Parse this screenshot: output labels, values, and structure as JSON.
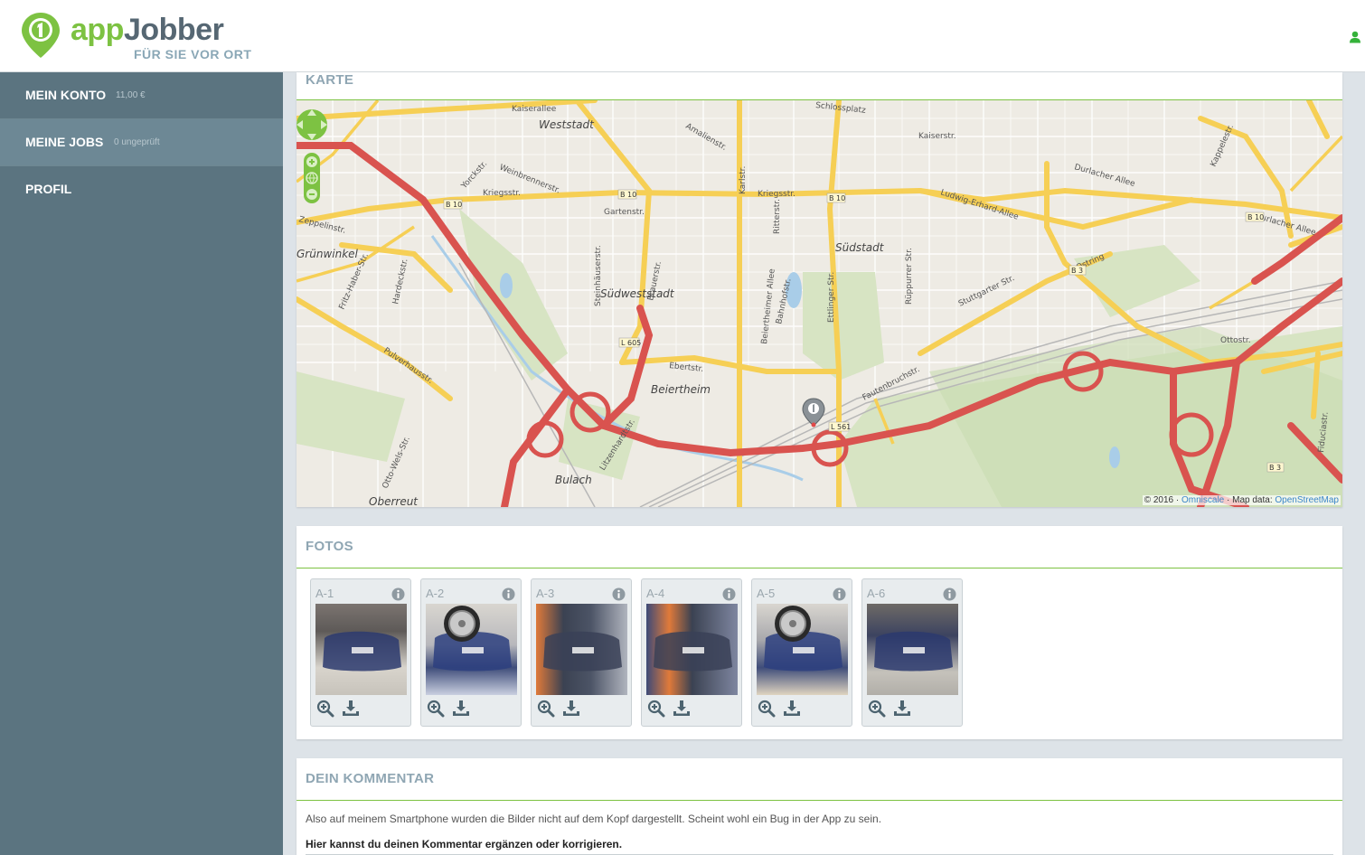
{
  "header": {
    "logo_app": "app",
    "logo_jobber": "Jobber",
    "logo_subtitle": "FÜR SIE VOR ORT",
    "brand_color": "#7dc242",
    "user_icon": "user-icon"
  },
  "sidebar": {
    "items": [
      {
        "label": "MEIN KONTO",
        "meta": "11,00 €"
      },
      {
        "label": "MEINE JOBS",
        "meta": "0 ungeprüft"
      },
      {
        "label": "PROFIL",
        "meta": ""
      }
    ]
  },
  "map_panel": {
    "title": "KARTE",
    "labels": {
      "weststadt": "Weststadt",
      "suedweststadt": "Südweststadt",
      "suedstadt": "Südstadt",
      "beiertheim": "Beiertheim",
      "bulach": "Bulach",
      "oberreut": "Oberreut",
      "gruenwinkel": "Grünwinkel",
      "kaiserallee": "Kaiserallee",
      "kaiserstr": "Kaiserstr.",
      "kriegsstr_w": "Kriegsstr.",
      "kriegsstr_e": "Kriegsstr.",
      "ludwig_erhard": "Ludwig-Erhard-Allee",
      "durlacher_allee": "Durlacher Allee",
      "durlacher_allee_2": "Durlacher Allee",
      "schlossplatz": "Schlossplatz",
      "amalienstr": "Amalienstr.",
      "gartenstr": "Gartenstr.",
      "weinbrennerstr": "Weinbrennerstr.",
      "yorckstr": "Yorckstr.",
      "zeppelinstr": "Zeppelinstr.",
      "ebertstr": "Ebertstr.",
      "stuttgarter": "Stuttgarter Str.",
      "ostring": "Ostring",
      "kappelestr": "Kappelestr.",
      "fautenbruchstr": "Fautenbruchstr.",
      "pulverhausstr": "Pulverhausstr.",
      "ottostr": "Ottostr.",
      "karlstr": "Karlstr.",
      "ettlinger": "Ettlinger Str.",
      "rueppurrer": "Rüppurrer Str.",
      "brauerstr": "Brauerstr.",
      "steinhaeuser": "Steinhäuserstr.",
      "litzenhardt": "Litzenhardtstr.",
      "otto_wels": "Otto-Wels-Str.",
      "fritz_haber": "Fritz-Haber-Str.",
      "hardeckstr": "Hardeckstr.",
      "fiduciastr": "Fiduciastr.",
      "beiertheimer": "Beiertheimer Allee",
      "bahnhofstr": "Bahnhofstr.",
      "ritterstr": "Ritterstr.",
      "b10_a": "B 10",
      "b10_b": "B 10",
      "b10_c": "B 10",
      "b10_d": "B 10",
      "b3_a": "B 3",
      "b3_b": "B 3",
      "l605": "L 605",
      "l561": "L 561"
    },
    "attribution_prefix": "© 2016 · ",
    "attribution_omniscale": "Omniscale",
    "attribution_middle": " · Map data: ",
    "attribution_osm": "OpenStreetMap",
    "road_primary_color": "#f6cf55",
    "road_motorway_color": "#d9534f",
    "park_color": "#d7e4c3"
  },
  "photos_panel": {
    "title": "FOTOS",
    "items": [
      {
        "label": "A-1"
      },
      {
        "label": "A-2"
      },
      {
        "label": "A-3"
      },
      {
        "label": "A-4"
      },
      {
        "label": "A-5"
      },
      {
        "label": "A-6"
      }
    ]
  },
  "comment_panel": {
    "title": "DEIN KOMMENTAR",
    "text": "Also auf meinem Smartphone wurden die Bilder nicht auf dem Kopf dargestellt. Scheint wohl ein Bug in der App zu sein.",
    "hint": "Hier kannst du deinen Kommentar ergänzen oder korrigieren."
  }
}
